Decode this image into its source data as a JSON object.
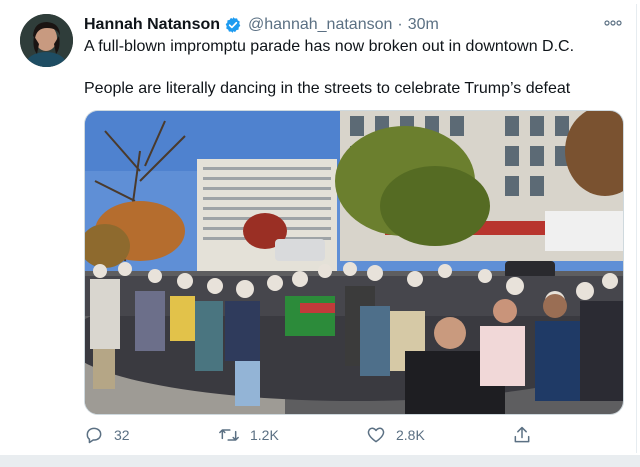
{
  "tweet": {
    "author_name": "Hannah Natanson",
    "handle": "@hannah_natanson",
    "separator": "·",
    "time": "30m",
    "text_line_1": "A full-blown impromptu parade has now broken out in downtown D.C.",
    "text_line_2": "People are literally dancing in the streets to celebrate Trump’s defeat",
    "verified": true
  },
  "actions": {
    "replies": "32",
    "retweets": "1.2K",
    "likes": "2.8K"
  },
  "icons": {
    "verified": "verified-badge-icon",
    "more": "more-options-icon",
    "reply": "reply-icon",
    "retweet": "retweet-icon",
    "like": "like-icon",
    "share": "share-icon"
  },
  "colors": {
    "verified_blue": "#1d9bf0",
    "text_primary": "#0f1419",
    "text_secondary": "#5b7083"
  }
}
